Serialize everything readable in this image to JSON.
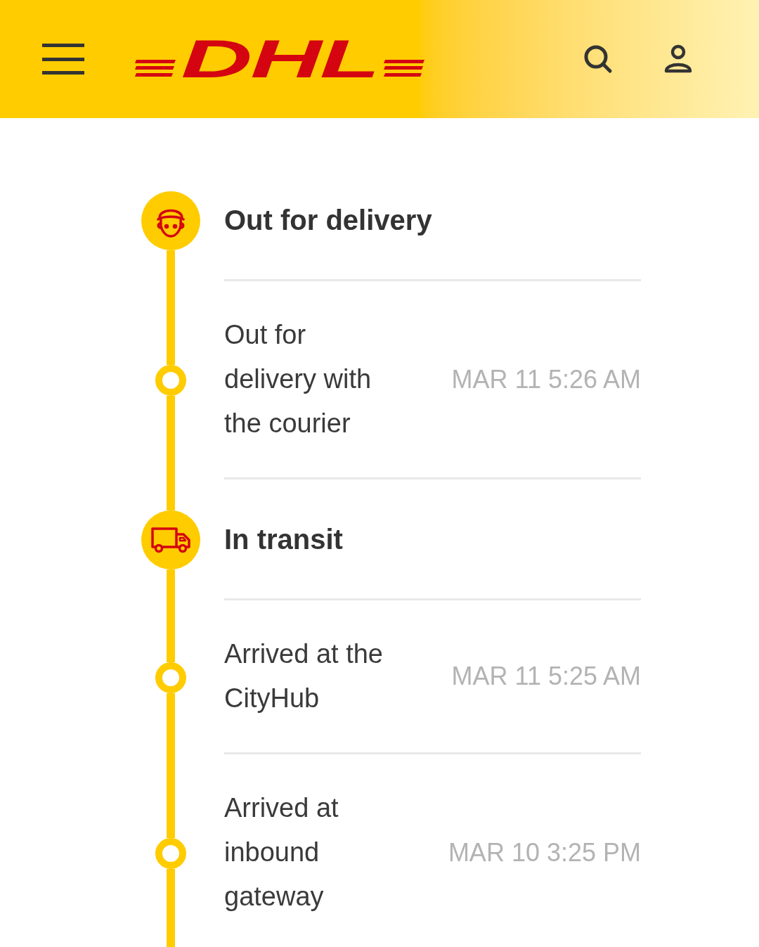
{
  "header": {
    "logo": "DHL"
  },
  "timeline": [
    {
      "kind": "status",
      "title": "Out for delivery"
    },
    {
      "kind": "event",
      "description": "Out for delivery with the courier",
      "time": "MAR 11 5:26 AM"
    },
    {
      "kind": "status",
      "title": "In transit"
    },
    {
      "kind": "event",
      "description": "Arrived at the CityHub",
      "time": "MAR 11 5:25 AM"
    },
    {
      "kind": "event",
      "description": "Arrived at inbound gateway",
      "time": "MAR 10 3:25 PM"
    }
  ]
}
